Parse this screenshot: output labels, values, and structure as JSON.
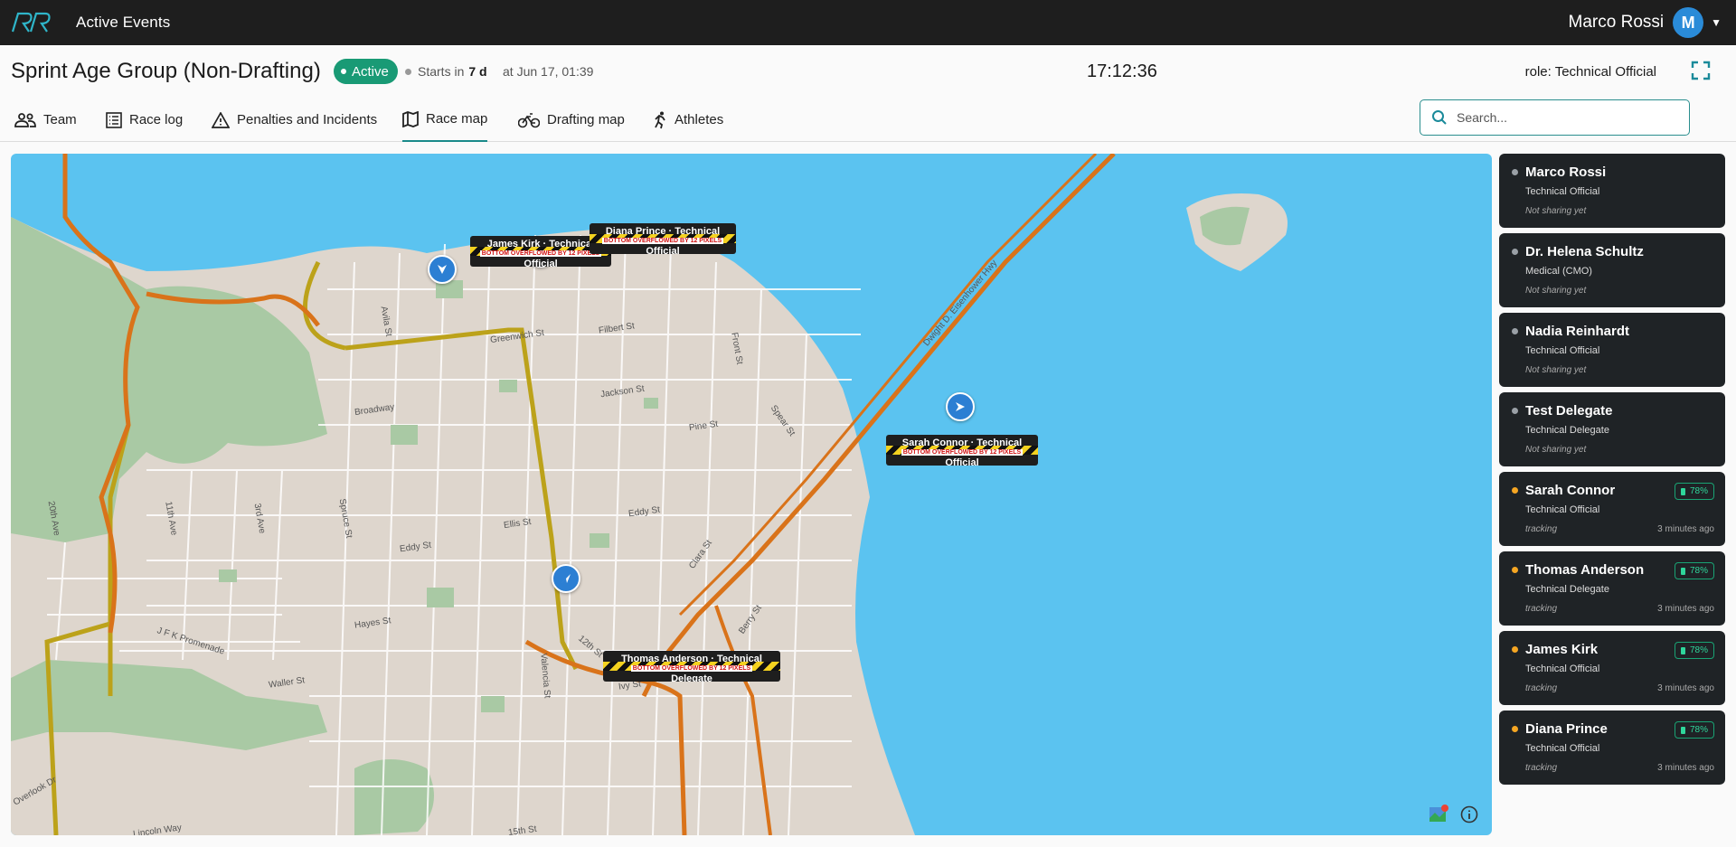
{
  "app": {
    "title": "Active Events",
    "logo_icon": "brand-logo-icon"
  },
  "user": {
    "name": "Marco Rossi",
    "avatar_letter": "M"
  },
  "event": {
    "title": "Sprint Age Group (Non-Drafting)",
    "status": "Active",
    "starts_label": "Starts in",
    "starts_value": "7 d",
    "starts_at": "at Jun 17, 01:39",
    "clock": "17:12:36",
    "role": "role: Technical Official"
  },
  "tabs": [
    {
      "label": "Team",
      "icon": "team-icon"
    },
    {
      "label": "Race log",
      "icon": "list-icon"
    },
    {
      "label": "Penalties and Incidents",
      "icon": "warning-icon"
    },
    {
      "label": "Race map",
      "icon": "map-icon",
      "active": true
    },
    {
      "label": "Drafting map",
      "icon": "bike-icon"
    },
    {
      "label": "Athletes",
      "icon": "runner-icon"
    }
  ],
  "search": {
    "placeholder": "Search..."
  },
  "map": {
    "markers": [
      {
        "line1": "James Kirk · Technical",
        "line2": "Official",
        "overflow": "BOTTOM OVERFLOWED BY 12 PIXELS"
      },
      {
        "line1": "Diana Prince · Technical",
        "line2": "Official",
        "overflow": "BOTTOM OVERFLOWED BY 12 PIXELS"
      },
      {
        "line1": "Sarah Connor · Technical",
        "line2": "Official",
        "overflow": "BOTTOM OVERFLOWED BY 12 PIXELS"
      },
      {
        "line1": "Thomas Anderson · Technical",
        "line2": "Delegate",
        "overflow": "BOTTOM OVERFLOWED BY 12 PIXELS"
      }
    ],
    "street_labels": [
      "Greenwich St",
      "Filbert St",
      "Jackson St",
      "Broadway",
      "Pine St",
      "Ellis St",
      "Eddy St",
      "Eddy St",
      "Hayes St",
      "Front St",
      "Spear St",
      "Dwight D. Eisenhower Hwy",
      "J F K Promenade",
      "Waller St",
      "12th St",
      "Valencia St",
      "15th St",
      "Clara St",
      "Berry St",
      "Ivy St",
      "Spruce St",
      "3rd Ave",
      "11th Ave",
      "20th Ave",
      "Lincoln Way",
      "Overlook Dr",
      "Avila St"
    ]
  },
  "people": [
    {
      "name": "Marco Rossi",
      "role": "Technical Official",
      "status": "Not sharing yet",
      "dot": "#9aa0a6"
    },
    {
      "name": "Dr. Helena Schultz",
      "role": "Medical (CMO)",
      "status": "Not sharing yet",
      "dot": "#9aa0a6"
    },
    {
      "name": "Nadia Reinhardt",
      "role": "Technical Official",
      "status": "Not sharing yet",
      "dot": "#9aa0a6"
    },
    {
      "name": "Test Delegate",
      "role": "Technical Delegate",
      "status": "Not sharing yet",
      "dot": "#9aa0a6"
    },
    {
      "name": "Sarah Connor",
      "role": "Technical Official",
      "status": "tracking",
      "ago": "3 minutes ago",
      "battery": "78%",
      "dot": "#f5a623"
    },
    {
      "name": "Thomas Anderson",
      "role": "Technical Delegate",
      "status": "tracking",
      "ago": "3 minutes ago",
      "battery": "78%",
      "dot": "#f5a623"
    },
    {
      "name": "James Kirk",
      "role": "Technical Official",
      "status": "tracking",
      "ago": "3 minutes ago",
      "battery": "78%",
      "dot": "#f5a623"
    },
    {
      "name": "Diana Prince",
      "role": "Technical Official",
      "status": "tracking",
      "ago": "3 minutes ago",
      "battery": "78%",
      "dot": "#f5a623"
    }
  ]
}
